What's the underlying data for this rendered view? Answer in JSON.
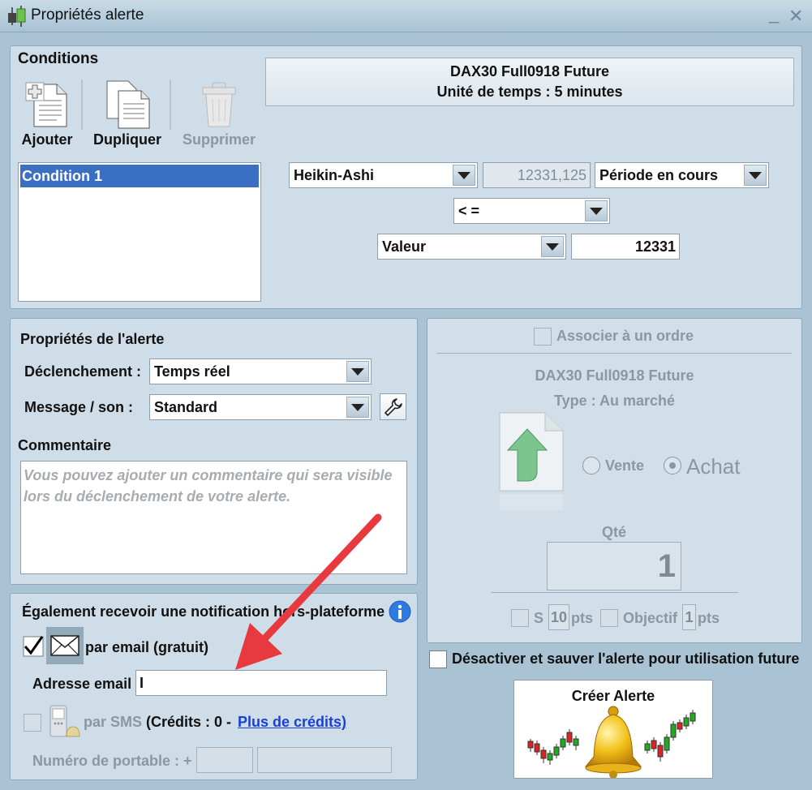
{
  "window": {
    "title": "Propriétés alerte",
    "minimize": "_",
    "close": "✕"
  },
  "conditions": {
    "heading": "Conditions",
    "buttons": {
      "add": "Ajouter",
      "duplicate": "Dupliquer",
      "delete": "Supprimer"
    },
    "items": [
      "Condition 1"
    ],
    "instrument": {
      "name": "DAX30 Full0918 Future",
      "timeframe": "Unité de temps : 5 minutes"
    },
    "row1": {
      "indicator": "Heikin-Ashi",
      "current_value": "12331,125",
      "period": "Période en cours"
    },
    "operator": "< =",
    "row3": {
      "type": "Valeur",
      "value": "12331"
    }
  },
  "alert_props": {
    "heading": "Propriétés de l'alerte",
    "trigger_label": "Déclenchement :",
    "trigger_value": "Temps réel",
    "message_label": "Message / son :",
    "message_value": "Standard",
    "comment_heading": "Commentaire",
    "comment_placeholder": "Vous pouvez ajouter un commentaire qui sera visible lors du déclenchement de votre alerte."
  },
  "notification": {
    "heading": "Également recevoir une notification hors-plateforme",
    "email_label": "par email (gratuit)",
    "email_checked": true,
    "address_label": "Adresse email",
    "address_value": "I",
    "sms_label": "par SMS",
    "credits_text": "(Crédits : 0 -",
    "more_credits": "Plus de crédits)",
    "phone_label": "Numéro de portable : +"
  },
  "order": {
    "associate_label": "Associer à un ordre",
    "instrument": "DAX30 Full0918 Future",
    "type": "Type : Au marché",
    "sell": "Vente",
    "buy": "Achat",
    "qty_label": "Qté",
    "qty_value": "1",
    "stop_label": "S",
    "stop_value": "10",
    "stop_unit": "pts",
    "target_label": "Objectif",
    "target_value": "1",
    "target_unit": "pts"
  },
  "footer": {
    "deactivate_label": "Désactiver et sauver l'alerte pour utilisation future",
    "create_button": "Créer Alerte"
  },
  "colors": {
    "selection": "#3a6fc4",
    "link": "#1a3fd6",
    "arrow": "#e8393f"
  }
}
